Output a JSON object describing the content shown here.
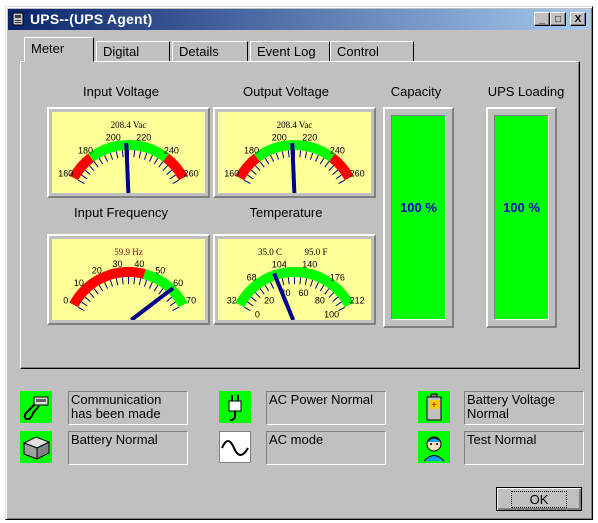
{
  "window": {
    "title": "UPS--(UPS Agent)",
    "icon": "ups-app-icon",
    "controls": {
      "minimize": "_",
      "maximize": "□",
      "close": "X"
    }
  },
  "tabs": [
    {
      "label": "Meter",
      "active": true
    },
    {
      "label": "Digital",
      "active": false
    },
    {
      "label": "Details",
      "active": false
    },
    {
      "label": "Event Log",
      "active": false
    },
    {
      "label": "Control",
      "active": false
    }
  ],
  "meters": {
    "input_voltage": {
      "label": "Input Voltage",
      "reading": "208.4 Vac",
      "scale": [
        "160",
        "180",
        "200",
        "220",
        "240",
        "260"
      ],
      "value": 208.4,
      "min": 160,
      "max": 260
    },
    "output_voltage": {
      "label": "Output Voltage",
      "reading": "208.4 Vac",
      "scale": [
        "160",
        "180",
        "200",
        "220",
        "240",
        "260"
      ],
      "value": 208.4,
      "min": 160,
      "max": 260
    },
    "input_frequency": {
      "label": "Input Frequency",
      "reading": "59.9 Hz",
      "scale": [
        "0",
        "10",
        "20",
        "30",
        "40",
        "50",
        "60",
        "70"
      ],
      "value": 59.9,
      "min": 0,
      "max": 70
    },
    "temperature": {
      "label": "Temperature",
      "reading_c": "35.0 C",
      "reading_f": "95.0 F",
      "scale_outer": [
        "32",
        "68",
        "104",
        "140",
        "176",
        "212"
      ],
      "scale_inner": [
        "0",
        "20",
        "40",
        "60",
        "80",
        "100"
      ],
      "value_c": 35.0,
      "min_c": 0,
      "max_c": 100
    }
  },
  "bars": {
    "capacity": {
      "label": "Capacity",
      "text": "100 %",
      "percent": 100
    },
    "ups_loading": {
      "label": "UPS Loading",
      "text": "100 %",
      "percent": 100
    }
  },
  "status": {
    "communication": {
      "text": "Communication has been made",
      "icon": "cable-plug-icon"
    },
    "ac_power": {
      "text": "AC Power Normal",
      "icon": "power-plug-icon"
    },
    "battery_voltage": {
      "text": "Battery Voltage Normal",
      "icon": "battery-icon"
    },
    "battery": {
      "text": "Battery Normal",
      "icon": "ups-box-icon"
    },
    "ac_mode": {
      "text": "AC mode",
      "icon": "sine-wave-icon"
    },
    "test": {
      "text": "Test Normal",
      "icon": "technician-icon"
    }
  },
  "ok_button": {
    "label": "OK"
  },
  "colors": {
    "gauge_face": "#ffff99",
    "red_zone": "#ff0000",
    "green_zone": "#00ff00",
    "needle": "#00008b",
    "bar_text": "#0000cc"
  }
}
